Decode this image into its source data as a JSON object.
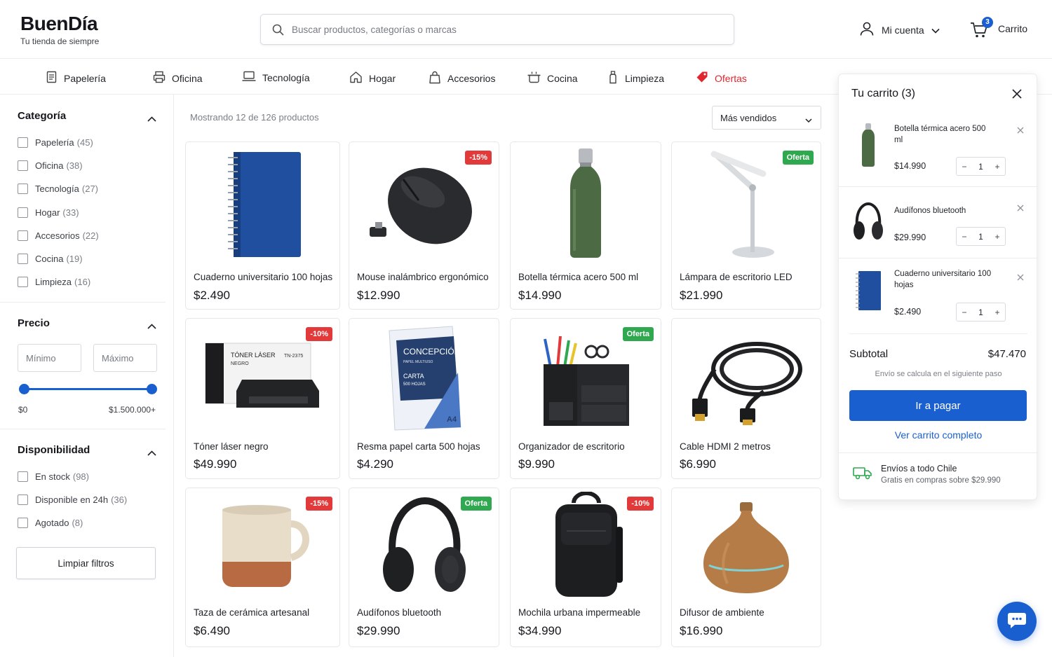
{
  "brand": {
    "name": "BuenDía",
    "tagline": "Tu tienda de siempre"
  },
  "search": {
    "placeholder": "Buscar productos, categorías o marcas",
    "value": ""
  },
  "account": {
    "label": "Mi cuenta"
  },
  "cart_header": {
    "label": "Carrito",
    "count": "3"
  },
  "categories_nav": [
    {
      "label": "Papelería",
      "icon": "notebook-icon"
    },
    {
      "label": "Oficina",
      "icon": "printer-icon"
    },
    {
      "label": "Tecnología",
      "icon": "laptop-icon"
    },
    {
      "label": "Hogar",
      "icon": "home-icon"
    },
    {
      "label": "Accesorios",
      "icon": "bag-icon"
    },
    {
      "label": "Cocina",
      "icon": "pot-icon"
    },
    {
      "label": "Limpieza",
      "icon": "spray-bottle-icon"
    },
    {
      "label": "Ofertas",
      "icon": "tag-icon"
    }
  ],
  "filters": {
    "category": {
      "title": "Categoría",
      "options": [
        {
          "label": "Papelería",
          "count": "(45)"
        },
        {
          "label": "Oficina",
          "count": "(38)"
        },
        {
          "label": "Tecnología",
          "count": "(27)"
        },
        {
          "label": "Hogar",
          "count": "(33)"
        },
        {
          "label": "Accesorios",
          "count": "(22)"
        },
        {
          "label": "Cocina",
          "count": "(19)"
        },
        {
          "label": "Limpieza",
          "count": "(16)"
        }
      ]
    },
    "price": {
      "title": "Precio",
      "min_placeholder": "Mínimo",
      "max_placeholder": "Máximo",
      "range_min_label": "$0",
      "range_max_label": "$1.500.000+",
      "selected_low_fraction": 0,
      "selected_high_fraction": 1
    },
    "availability": {
      "title": "Disponibilidad",
      "options": [
        {
          "label": "En stock",
          "count": "(98)"
        },
        {
          "label": "Disponible en 24h",
          "count": "(36)"
        },
        {
          "label": "Agotado",
          "count": "(8)"
        }
      ]
    },
    "clear_label": "Limpiar filtros"
  },
  "results": {
    "summary": "Mostrando 12 de 126 productos",
    "sort_label": "Más vendidos"
  },
  "products": [
    {
      "name": "Cuaderno universitario 100 hojas",
      "price": "$2.490",
      "badge": ""
    },
    {
      "name": "Mouse inalámbrico ergonómico",
      "price": "$12.990",
      "badge": "-15%"
    },
    {
      "name": "Botella térmica acero 500 ml",
      "price": "$14.990",
      "badge": ""
    },
    {
      "name": "Lámpara de escritorio LED",
      "price": "$21.990",
      "badge": "Oferta"
    },
    {
      "name": "Tóner láser negro",
      "price": "$49.990",
      "badge": "-10%"
    },
    {
      "name": "Resma papel carta 500 hojas",
      "price": "$4.290",
      "badge": ""
    },
    {
      "name": "Organizador de escritorio",
      "price": "$9.990",
      "badge": "Oferta"
    },
    {
      "name": "Cable HDMI 2 metros",
      "price": "$6.990",
      "badge": ""
    },
    {
      "name": "Taza de cerámica artesanal",
      "price": "$6.490",
      "badge": "-15%"
    },
    {
      "name": "Audífonos bluetooth",
      "price": "$29.990",
      "badge": "Oferta"
    },
    {
      "name": "Mochila urbana impermeable",
      "price": "$34.990",
      "badge": "-10%"
    },
    {
      "name": "Difusor de ambiente",
      "price": "$16.990",
      "badge": ""
    }
  ],
  "product_art": {
    "toner_box_labels": [
      "TÓNER LÁSER",
      "NEGRO",
      "TN-2375"
    ],
    "paper_ream_labels": [
      "CONCEPCIÓN",
      "PAPEL MULTIUSO",
      "CARTA",
      "500 HOJAS",
      "A4"
    ]
  },
  "cart_panel": {
    "title": "Tu carrito (3)",
    "items": [
      {
        "name": "Botella térmica acero 500 ml",
        "price": "$14.990",
        "qty": "1"
      },
      {
        "name": "Audífonos bluetooth",
        "price": "$29.990",
        "qty": "1"
      },
      {
        "name": "Cuaderno universitario 100 hojas",
        "price": "$2.490",
        "qty": "1"
      }
    ],
    "subtotal_label": "Subtotal",
    "subtotal_value": "$47.470",
    "shipping_note": "Envío se calcula en el siguiente paso",
    "pay_label": "Ir a pagar",
    "view_cart_label": "Ver carrito completo",
    "shipping_title": "Envíos a todo Chile",
    "shipping_sub": "Gratis en compras sobre $29.990"
  },
  "colors": {
    "primary": "#1a5fd0",
    "discount": "#e23a3a",
    "offer": "#2fa84f",
    "offers_nav": "#e0262f"
  }
}
